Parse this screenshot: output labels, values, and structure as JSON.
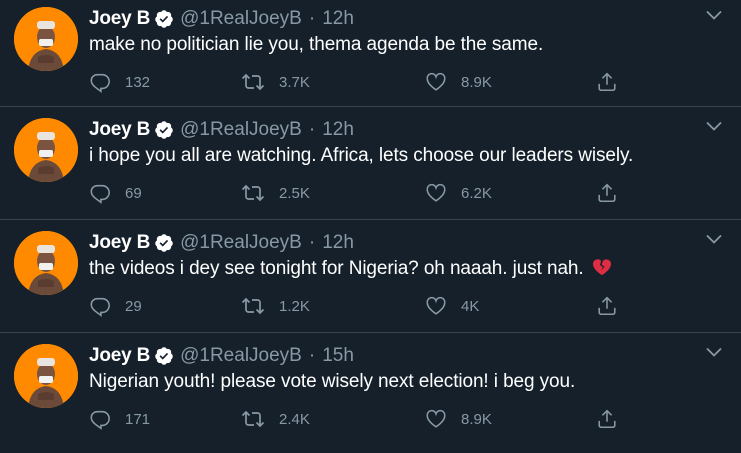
{
  "colors": {
    "background": "#15202b",
    "divider": "#38444d",
    "secondary_text": "#8899a6",
    "verified_badge": "#ffffff",
    "avatar_bg": "#ff8a00"
  },
  "tweets": [
    {
      "name": "Joey B",
      "handle": "@1RealJoeyB",
      "separator": "·",
      "time": "12h",
      "text": "make no politician lie you, thema agenda be the same.",
      "replies": "132",
      "retweets": "3.7K",
      "likes": "8.9K"
    },
    {
      "name": "Joey B",
      "handle": "@1RealJoeyB",
      "separator": "·",
      "time": "12h",
      "text": "i hope you all are watching. Africa, lets choose our leaders wisely.",
      "replies": "69",
      "retweets": "2.5K",
      "likes": "6.2K"
    },
    {
      "name": "Joey B",
      "handle": "@1RealJoeyB",
      "separator": "·",
      "time": "12h",
      "text": "the videos i dey see tonight for Nigeria? oh naaah. just nah.",
      "emoji": "broken-heart-emoji",
      "replies": "29",
      "retweets": "1.2K",
      "likes": "4K"
    },
    {
      "name": "Joey B",
      "handle": "@1RealJoeyB",
      "separator": "·",
      "time": "15h",
      "text": "Nigerian youth! please vote wisely next election! i beg you.",
      "replies": "171",
      "retweets": "2.4K",
      "likes": "8.9K"
    }
  ]
}
